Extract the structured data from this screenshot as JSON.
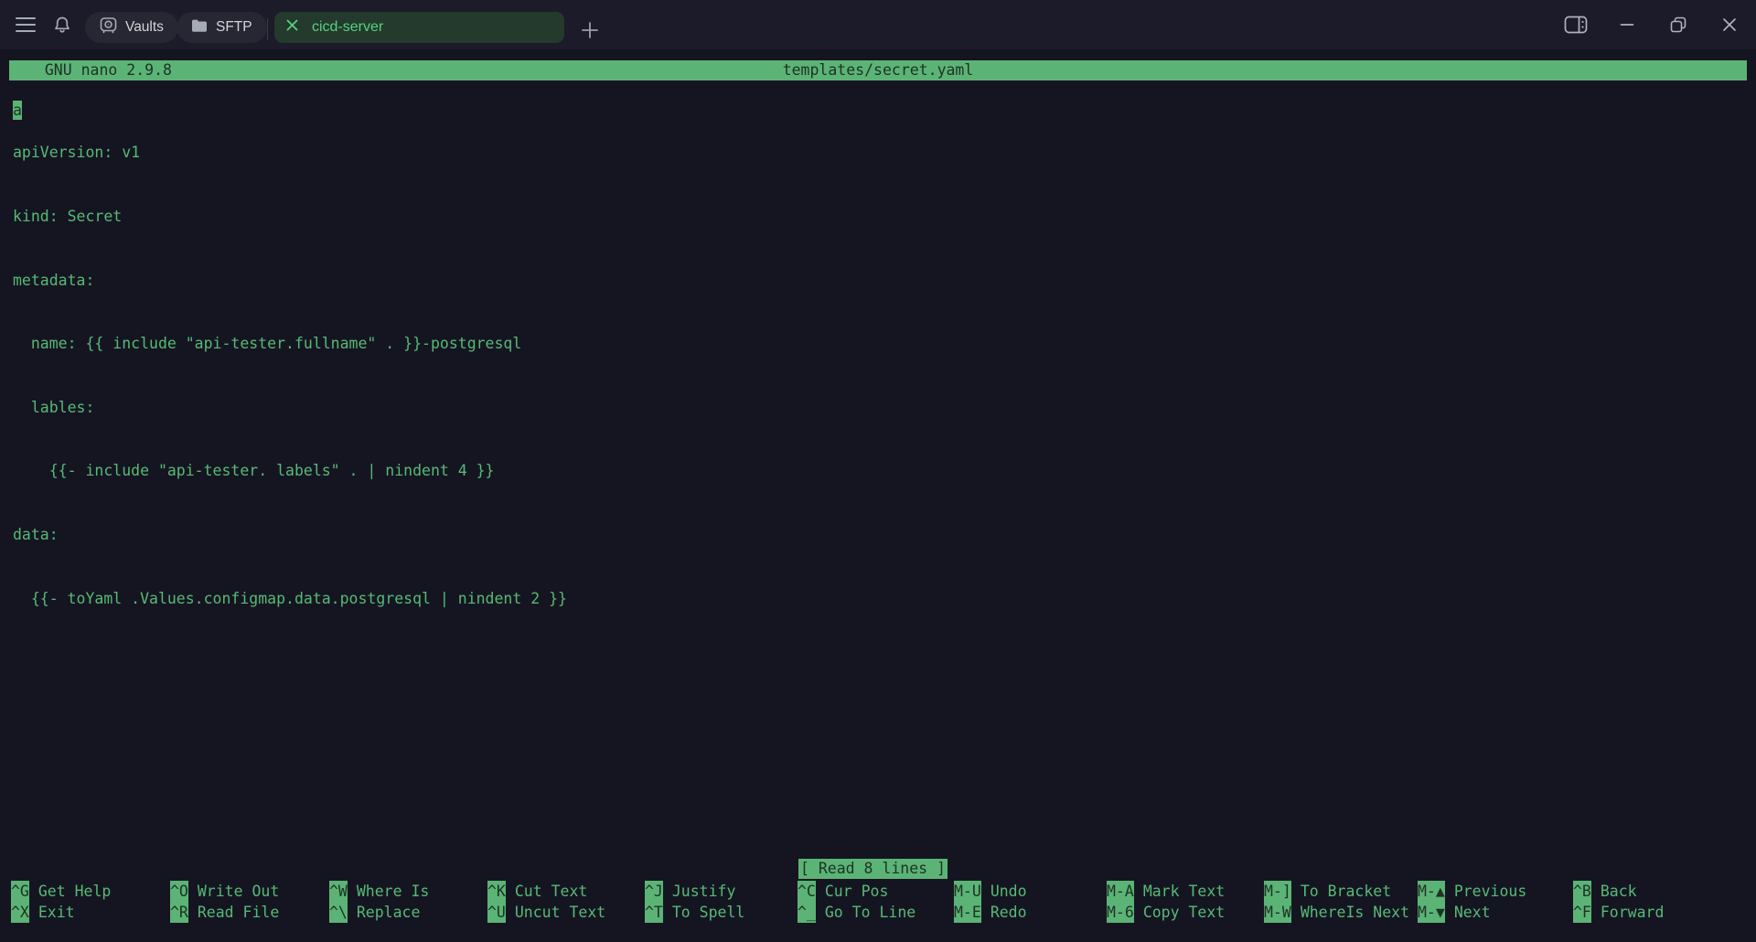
{
  "topbar": {
    "tabs": [
      {
        "label": "Vaults"
      },
      {
        "label": "SFTP"
      }
    ],
    "active_tab": {
      "label": "cicd-server"
    }
  },
  "nano": {
    "title_left": "  GNU nano 2.9.8",
    "title_file": "templates/secret.yaml",
    "cursor_char": "a",
    "lines": [
      "apiVersion: v1",
      "kind: Secret",
      "metadata:",
      "  name: {{ include \"api-tester.fullname\" . }}-postgresql",
      "  lables:",
      "    {{- include \"api-tester. labels\" . | nindent 4 }}",
      "data:",
      "  {{- toYaml .Values.configmap.data.postgresql | nindent 2 }}"
    ],
    "status": "[ Read 8 lines ]",
    "shortcut_columns": [
      {
        "top": {
          "key": "^G",
          "label": "Get Help"
        },
        "bottom": {
          "key": "^X",
          "label": "Exit"
        }
      },
      {
        "top": {
          "key": "^O",
          "label": "Write Out"
        },
        "bottom": {
          "key": "^R",
          "label": "Read File"
        }
      },
      {
        "top": {
          "key": "^W",
          "label": "Where Is"
        },
        "bottom": {
          "key": "^\\",
          "label": "Replace"
        }
      },
      {
        "top": {
          "key": "^K",
          "label": "Cut Text"
        },
        "bottom": {
          "key": "^U",
          "label": "Uncut Text"
        }
      },
      {
        "top": {
          "key": "^J",
          "label": "Justify"
        },
        "bottom": {
          "key": "^T",
          "label": "To Spell"
        }
      },
      {
        "top": {
          "key": "^C",
          "label": "Cur Pos"
        },
        "bottom": {
          "key": "^_",
          "label": "Go To Line"
        }
      },
      {
        "top": {
          "key": "M-U",
          "label": "Undo"
        },
        "bottom": {
          "key": "M-E",
          "label": "Redo"
        }
      },
      {
        "top": {
          "key": "M-A",
          "label": "Mark Text"
        },
        "bottom": {
          "key": "M-6",
          "label": "Copy Text"
        }
      },
      {
        "top": {
          "key": "M-]",
          "label": "To Bracket"
        },
        "bottom": {
          "key": "M-W",
          "label": "WhereIs Next"
        }
      },
      {
        "top": {
          "key": "M-▲",
          "label": "Previous"
        },
        "bottom": {
          "key": "M-▼",
          "label": "Next"
        }
      },
      {
        "top": {
          "key": "^B",
          "label": "Back"
        },
        "bottom": {
          "key": "^F",
          "label": "Forward"
        }
      }
    ]
  },
  "colors": {
    "accent_green": "#5bb475",
    "text_green": "#56ba74",
    "active_tab_bg": "#233a2c",
    "active_tab_text": "#58d084",
    "topbar_bg": "#1b1b29",
    "terminal_bg": "#151522"
  }
}
